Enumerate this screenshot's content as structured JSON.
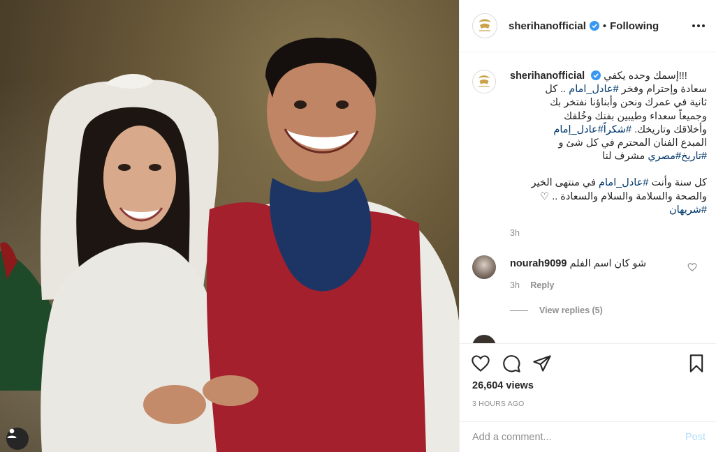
{
  "post": {
    "username": "sherihanofficial",
    "follow_separator": "•",
    "follow_status": "Following",
    "more_icon": "more-options-icon"
  },
  "caption": {
    "username": "sherihanofficial",
    "lines": [
      "إسمك وحده يكفي!!!",
      "سعادة وإحترام وفخر",
      "..",
      "كل",
      "ثانية في عمرك ونحن وأبناؤنا نفتخر بك",
      "وجميعاً سعداء وطيبين بفنك وخُلقك",
      "وأخلاقك وتاريخك.",
      "المبدع الفنان المحترم في كل شئ و",
      "مشرف لنا",
      "كل سنة وأنت",
      "في منتهى الخير",
      "والصحة والسلامة والسلام والسعادة ..",
      "♡"
    ],
    "tags": {
      "adel_imam": "#عادل_امام",
      "thanks": "#شكراً",
      "adel_imam2": "#عادل_إمام",
      "history": "#تاريخ",
      "egyptian": "#مصري",
      "sherihan": "#شريهان"
    },
    "time": "3h"
  },
  "comments": [
    {
      "username": "nourah9099",
      "text": "شو كان اسم الفلم",
      "time": "3h",
      "reply_label": "Reply",
      "view_replies": "View replies (5)"
    }
  ],
  "stats": {
    "views": "26,604 views",
    "posted_ago": "3 HOURS AGO"
  },
  "composer": {
    "placeholder": "Add a comment...",
    "post_label": "Post"
  },
  "colors": {
    "link": "#00376b",
    "muted": "#8e8e8e",
    "verified": "#3897f0",
    "post_disabled": "#b2dffc"
  }
}
